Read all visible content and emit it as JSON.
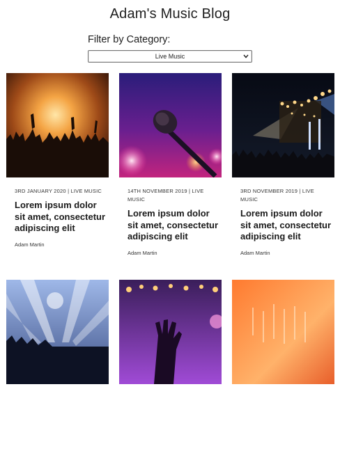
{
  "blog": {
    "title": "Adam's Music Blog",
    "filter_label": "Filter by Category:",
    "filter_selected": "Live Music"
  },
  "posts": [
    {
      "meta": "3rd January 2020 | Live Music",
      "headline": "Lorem ipsum dolor sit amet, consectetur adipiscing elit",
      "author": "Adam Martin"
    },
    {
      "meta": "14th November 2019 | Live Music",
      "headline": "Lorem ipsum dolor sit amet, consectetur adipiscing elit",
      "author": "Adam Martin"
    },
    {
      "meta": "3rd November 2019 | Live Music",
      "headline": "Lorem ipsum dolor sit amet, consectetur adipiscing elit",
      "author": "Adam Martin"
    }
  ],
  "colors": {
    "text": "#1e1e1e",
    "select_border": "#777777"
  }
}
